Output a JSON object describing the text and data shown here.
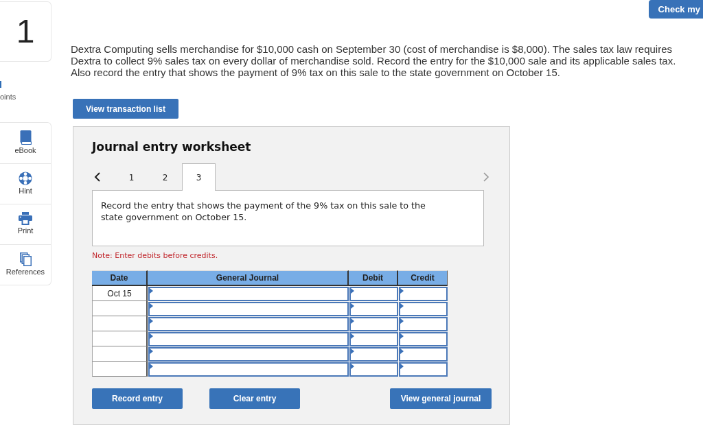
{
  "question": {
    "number": "1",
    "points_label": "oints"
  },
  "tools": [
    {
      "kind": "ebook",
      "label": "eBook"
    },
    {
      "kind": "hint",
      "label": "Hint"
    },
    {
      "kind": "print",
      "label": "Print"
    },
    {
      "kind": "references",
      "label": "References"
    }
  ],
  "header": {
    "check_button": "Check my"
  },
  "problem_text": "Dextra Computing sells merchandise for $10,000 cash on September 30 (cost of merchandise is $8,000). The sales tax law requires Dextra to collect 9% sales tax on every dollar of merchandise sold. Record the entry for the $10,000 sale and its applicable sales tax. Also record the entry that shows the payment of 9% tax on this sale to the state government on October 15.",
  "transaction_list_button": "View transaction list",
  "worksheet": {
    "title": "Journal entry worksheet",
    "prev_button": {
      "disabled": false
    },
    "next_button": {
      "disabled": true
    },
    "tabs": [
      {
        "label": "1",
        "selected": false
      },
      {
        "label": "2",
        "selected": false
      },
      {
        "label": "3",
        "selected": true
      }
    ],
    "instruction": "Record the entry that shows the payment of the 9% tax on this sale to the state government on October 15.",
    "note": "Note: Enter debits before credits.",
    "table": {
      "columns": [
        "Date",
        "General Journal",
        "Debit",
        "Credit"
      ],
      "rows": [
        {
          "date": "Oct 15"
        },
        {},
        {},
        {},
        {},
        {}
      ]
    },
    "buttons": [
      "Record entry",
      "Clear entry",
      "View general journal"
    ]
  }
}
